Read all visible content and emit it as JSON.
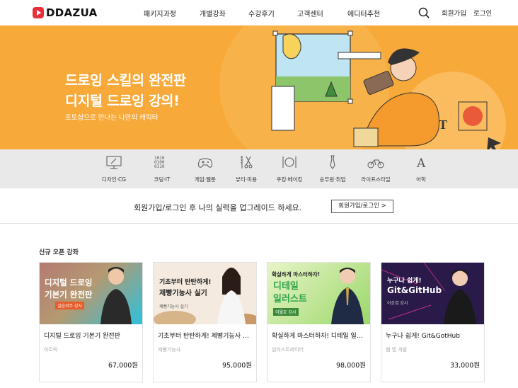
{
  "brand": {
    "name": "DDAZUA",
    "color": "#e8303a"
  },
  "header": {
    "nav": [
      "패키지과정",
      "개별강좌",
      "수강후기",
      "고객센터",
      "에디터추천"
    ],
    "search_icon": "search-icon",
    "signup": "회원가입",
    "login": "로그인"
  },
  "banner": {
    "title_line1": "드로잉 스킬의 완전판",
    "title_line2": "디지털 드로잉 강의!",
    "subtitle": "포토샵으로 만나는 나만의 캐릭터",
    "bg_color": "#f7a93a"
  },
  "categories": [
    {
      "label": "디자인·CG",
      "icon": "monitor-pen-icon"
    },
    {
      "label": "코딩·IT",
      "icon": "binary-code-icon"
    },
    {
      "label": "게임·웹툰",
      "icon": "gamepad-icon"
    },
    {
      "label": "뷰티·미용",
      "icon": "scissors-comb-icon"
    },
    {
      "label": "쿠킹·베이킹",
      "icon": "fork-plate-knife-icon"
    },
    {
      "label": "승무원·취업",
      "icon": "necktie-icon"
    },
    {
      "label": "라이프스타일",
      "icon": "bicycle-icon"
    },
    {
      "label": "어학",
      "icon": "letter-a-icon"
    }
  ],
  "prompt": {
    "text": "회원가입/로그인 후 나의 실력을 업그레이드 하세요.",
    "button": "회원가입/로그인 >"
  },
  "section": {
    "title": "신규 오픈 강좌",
    "cards": [
      {
        "title": "디지털 드로잉 기본기 완전판",
        "instructor": "아트릭",
        "price": "67,000원",
        "thumb": {
          "line1": "디지털 드로잉",
          "line2": "기본기 완전판",
          "badge": "실습위주 강사"
        }
      },
      {
        "title": "기초부터 탄탄하게! 제빵기능사 실기",
        "instructor": "제빵기능사",
        "price": "95,000원",
        "thumb": {
          "line1": "기초부터 탄탄하게!",
          "line2": "제빵기능사 실기",
          "badge": "제빵기능사 실기"
        }
      },
      {
        "title": "확실하게 마스터하자! 디테일 일러스트",
        "instructor": "일러스트레이터",
        "price": "98,000원",
        "thumb": {
          "line1": "확실하게 마스터하자!",
          "line2": "디테일",
          "line3": "일러스트",
          "badge": "이월호 강사"
        }
      },
      {
        "title": "누구나 쉽게! Git&GotHub",
        "instructor": "웹 앱 개발",
        "price": "33,000원",
        "thumb": {
          "line1": "누구나 쉽게!",
          "line2": "Git&GitHub",
          "badge": "이상엽 강사"
        }
      }
    ]
  }
}
